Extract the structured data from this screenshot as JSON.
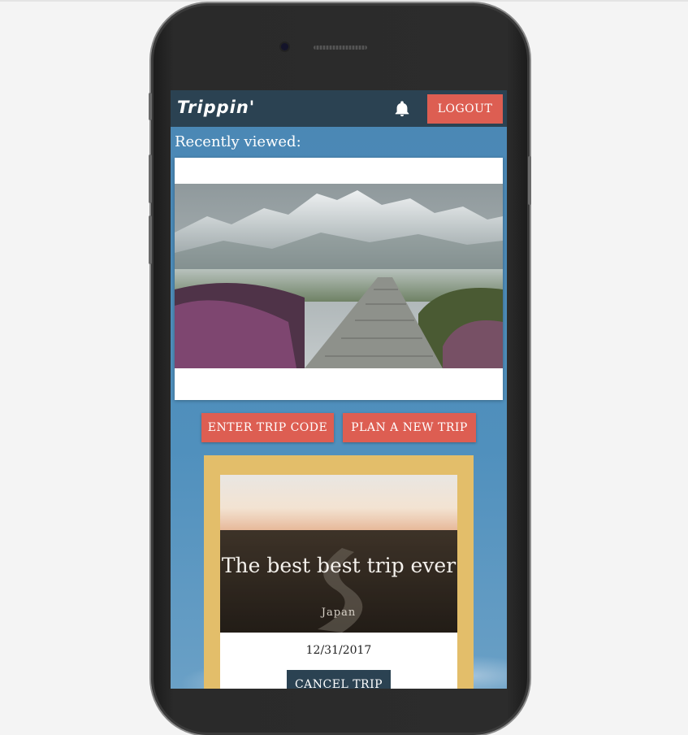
{
  "app": {
    "brand": "Trippin'",
    "logout_label": "LOGOUT"
  },
  "recent": {
    "label": "Recently viewed:"
  },
  "actions": {
    "enter_code_label": "ENTER TRIP CODE",
    "plan_trip_label": "PLAN A NEW TRIP"
  },
  "trip": {
    "title": "The best best trip ever",
    "location": "Japan",
    "date": "12/31/2017",
    "cancel_label": "CANCEL TRIP"
  },
  "icons": {
    "notifications": "bell-icon"
  },
  "colors": {
    "navbar": "#2b4252",
    "accent_red": "#dd5e52",
    "background_blue": "#4f8dba",
    "card_gold": "#e3be6a"
  }
}
